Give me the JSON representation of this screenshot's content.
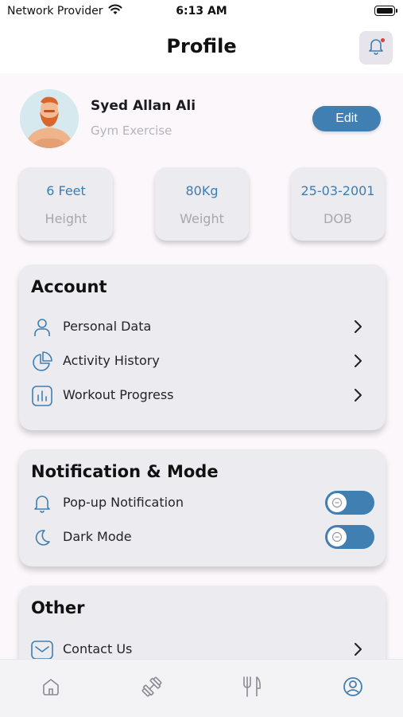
{
  "status_bar": {
    "provider": "Network Provider",
    "time": "6:13 AM"
  },
  "header": {
    "title": "Profile",
    "bell_icon": "bell-icon"
  },
  "profile": {
    "name": "Syed Allan Ali",
    "role": "Gym Exercise",
    "edit_label": "Edit"
  },
  "stats": [
    {
      "value": "6 Feet",
      "label": "Height"
    },
    {
      "value": "80Kg",
      "label": "Weight"
    },
    {
      "value": "25-03-2001",
      "label": "DOB"
    }
  ],
  "account": {
    "heading": "Account",
    "items": [
      {
        "label": "Personal Data",
        "icon": "user-icon"
      },
      {
        "label": "Activity History",
        "icon": "pie-chart-icon"
      },
      {
        "label": "Workout Progress",
        "icon": "bar-chart-icon"
      }
    ]
  },
  "notification": {
    "heading": "Notification & Mode",
    "items": [
      {
        "label": "Pop-up Notification",
        "icon": "bell-icon"
      },
      {
        "label": "Dark Mode",
        "icon": "moon-icon"
      }
    ]
  },
  "other": {
    "heading": "Other",
    "items": [
      {
        "label": "Contact Us",
        "icon": "mail-icon"
      }
    ]
  },
  "tabbar": {
    "tabs": [
      "home-icon",
      "dumbbell-icon",
      "fork-knife-icon",
      "profile-icon"
    ],
    "active": "profile-icon"
  },
  "colors": {
    "accent": "#3f7fb2",
    "card": "#ecebf0",
    "muted": "#a7a7ae"
  }
}
